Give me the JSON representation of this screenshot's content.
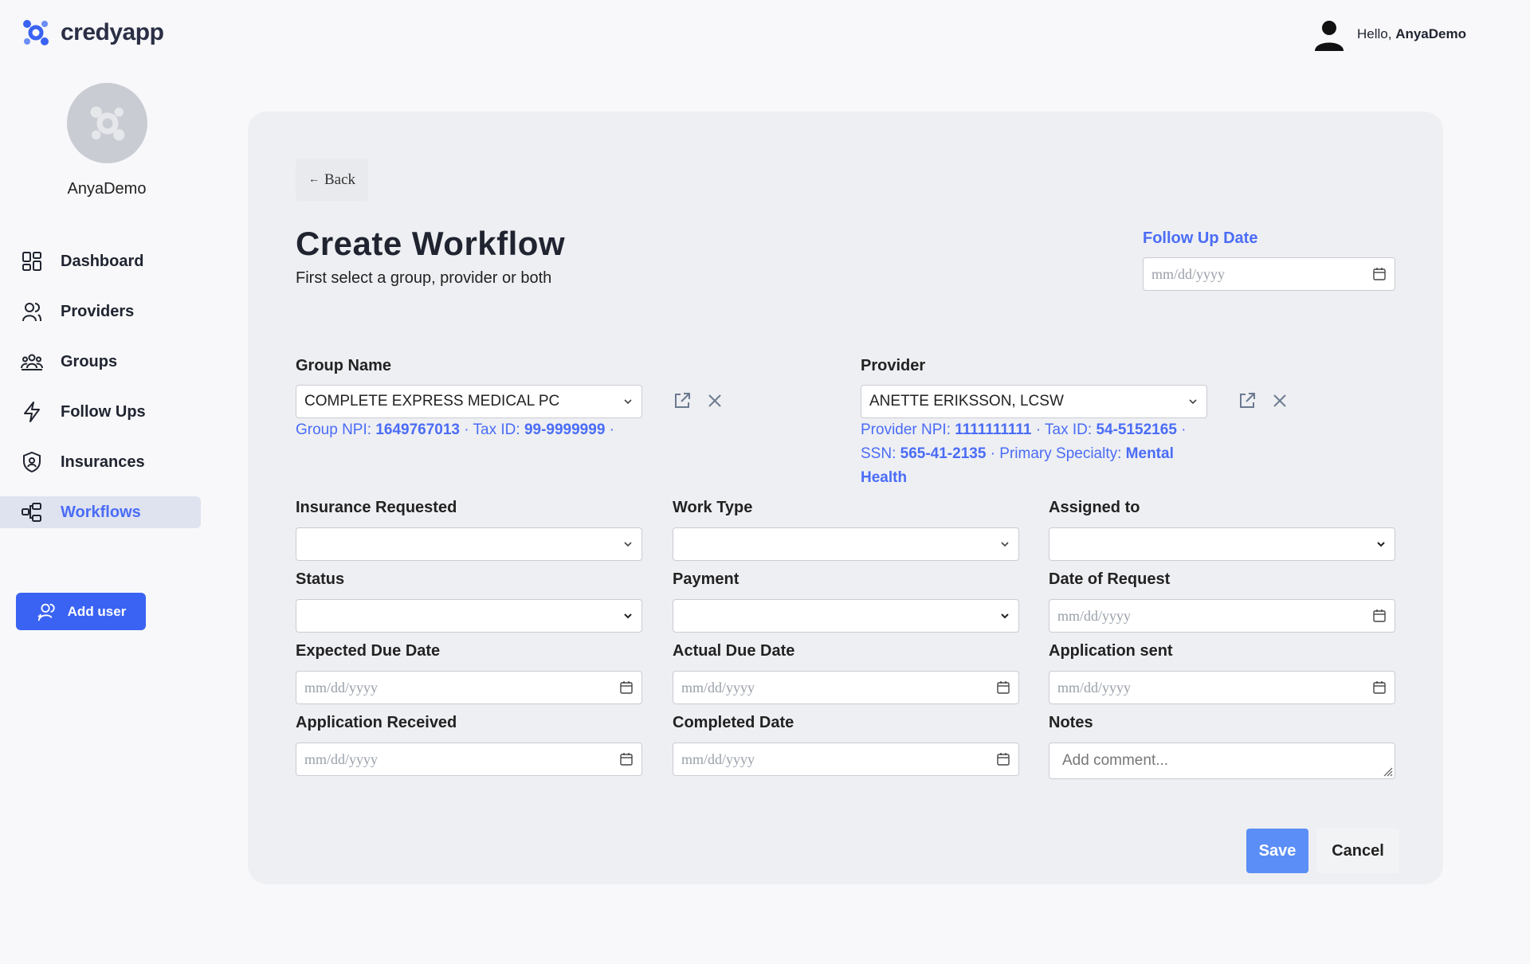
{
  "app": {
    "brand": "credyapp",
    "accent": "#4a6cf7"
  },
  "topbar": {
    "greeting": "Hello,",
    "username": "AnyaDemo"
  },
  "sidebar": {
    "profile_name": "AnyaDemo",
    "items": [
      {
        "label": "Dashboard",
        "icon": "dashboard-icon"
      },
      {
        "label": "Providers",
        "icon": "providers-icon"
      },
      {
        "label": "Groups",
        "icon": "groups-icon"
      },
      {
        "label": "Follow Ups",
        "icon": "lightning-icon"
      },
      {
        "label": "Insurances",
        "icon": "shield-icon"
      },
      {
        "label": "Workflows",
        "icon": "workflow-icon",
        "active": true
      }
    ],
    "add_user_label": "Add user"
  },
  "form": {
    "back_label": "Back",
    "title": "Create Workflow",
    "subtitle": "First select a group, provider or both",
    "follow_up_label": "Follow Up Date",
    "date_placeholder": "mm/dd/yyyy",
    "group": {
      "label": "Group Name",
      "value": "COMPLETE EXPRESS MEDICAL PC",
      "npi_label": "Group NPI:",
      "npi": "1649767013",
      "tax_label": "· Tax ID:",
      "tax": "99-9999999",
      "trail": "·"
    },
    "provider": {
      "label": "Provider",
      "value": "ANETTE ERIKSSON, LCSW",
      "npi_label": "Provider NPI:",
      "npi": "1111111111",
      "tax_label": "· Tax ID:",
      "tax": "54-5152165",
      "ssn_label": "· SSN:",
      "ssn": "565-41-2135",
      "spec_label": "· Primary Specialty:",
      "spec": "Mental Health"
    },
    "insurance_label": "Insurance Requested",
    "work_type_label": "Work Type",
    "assigned_label": "Assigned to",
    "status_label": "Status",
    "payment_label": "Payment",
    "request_date_label": "Date of Request",
    "expected_due_label": "Expected Due Date",
    "actual_due_label": "Actual Due Date",
    "app_sent_label": "Application sent",
    "app_received_label": "Application Received",
    "completed_label": "Completed Date",
    "notes_label": "Notes",
    "notes_placeholder": "Add comment...",
    "save_label": "Save",
    "cancel_label": "Cancel"
  }
}
